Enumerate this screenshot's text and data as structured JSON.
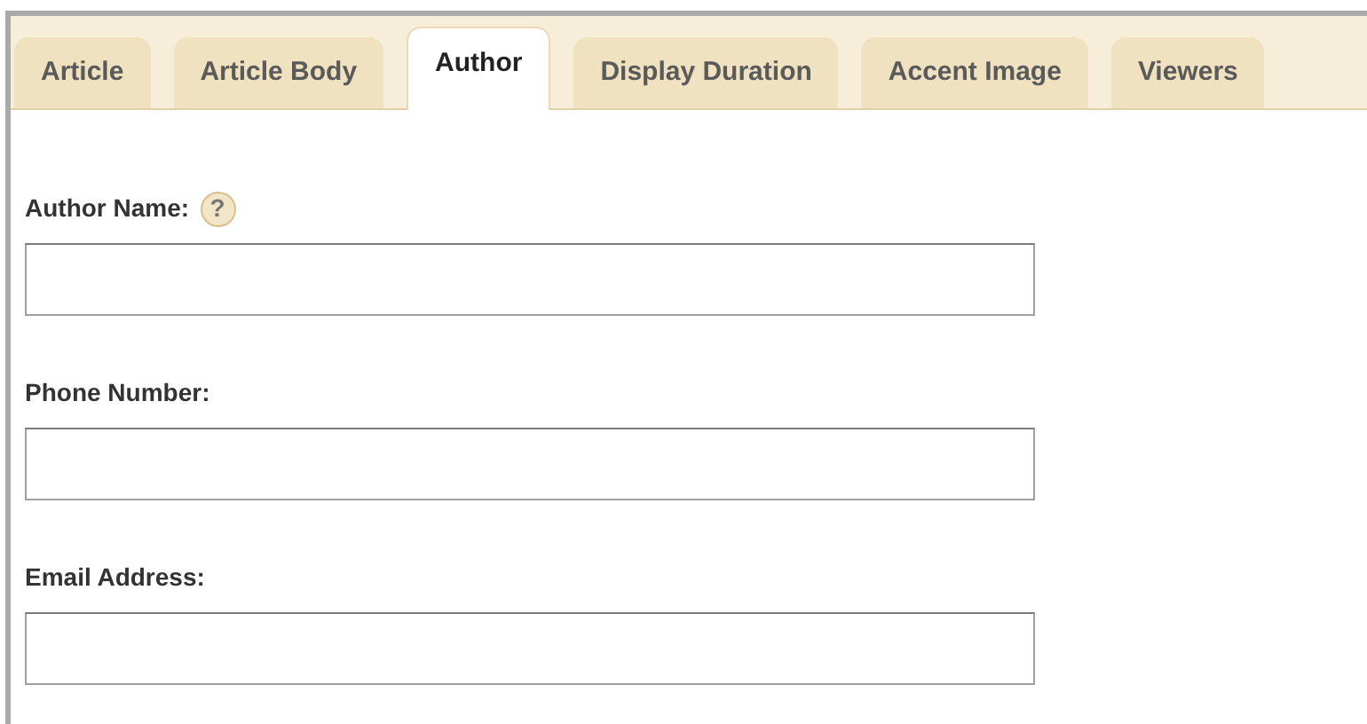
{
  "tabs": [
    {
      "label": "Article",
      "selected": false
    },
    {
      "label": "Article Body",
      "selected": false
    },
    {
      "label": "Author",
      "selected": true
    },
    {
      "label": "Display Duration",
      "selected": false
    },
    {
      "label": "Accent Image",
      "selected": false
    },
    {
      "label": "Viewers",
      "selected": false
    }
  ],
  "fields": [
    {
      "label": "Author Name:",
      "help": "?"
    },
    {
      "label": "Phone Number:"
    },
    {
      "label": "Email Address:"
    }
  ]
}
